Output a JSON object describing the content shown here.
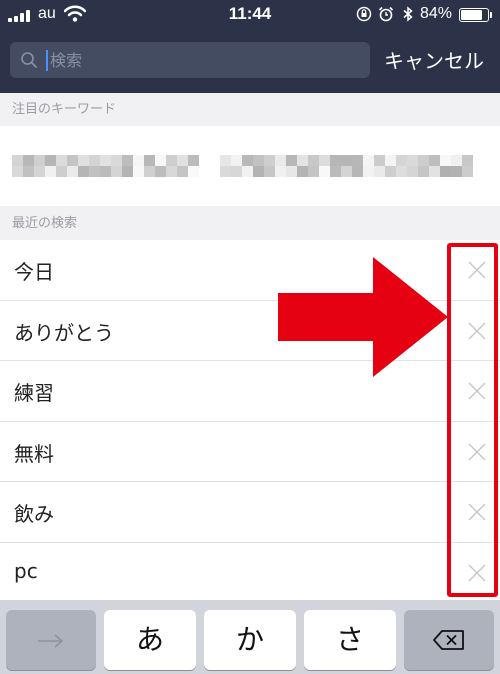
{
  "status_bar": {
    "carrier": "au",
    "time": "11:44",
    "battery_percent": "84%",
    "battery_level": 0.84
  },
  "search": {
    "placeholder": "検索",
    "cancel_label": "キャンセル"
  },
  "sections": {
    "featured_keywords": "注目のキーワード",
    "recent_searches": "最近の検索"
  },
  "recent_searches": [
    {
      "label": "今日"
    },
    {
      "label": "ありがとう"
    },
    {
      "label": "練習"
    },
    {
      "label": "無料"
    },
    {
      "label": "飲み"
    },
    {
      "label": "pc"
    }
  ],
  "annotation": {
    "color": "#e50012"
  },
  "keyboard": {
    "keys": [
      "あ",
      "か",
      "さ"
    ],
    "next_icon": "arrow-right-icon",
    "delete_icon": "backspace-icon"
  },
  "colors": {
    "header_bg": "#2c3349",
    "search_field_bg": "#444c61",
    "cursor": "#4a90ff"
  }
}
